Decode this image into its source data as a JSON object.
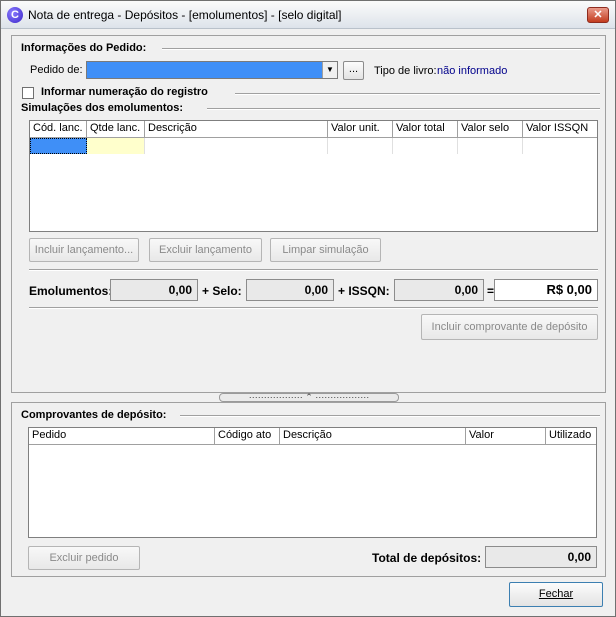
{
  "window": {
    "title": "Nota de entrega - Depósitos - [emolumentos] - [selo digital]",
    "close_glyph": "✕"
  },
  "pedido_info": {
    "group_title": "Informações do Pedido:",
    "pedido_label": "Pedido de:",
    "pedido_value": "",
    "browse_label": "...",
    "tipo_livro_label": "Tipo de livro:",
    "tipo_livro_value": "não informado"
  },
  "informar_numeracao": {
    "label": "Informar numeração do registro",
    "checked": false
  },
  "simulacoes": {
    "group_title": "Simulações dos emolumentos:",
    "columns": [
      "Cód. lanc.",
      "Qtde lanc.",
      "Descrição",
      "Valor unit.",
      "Valor total",
      "Valor selo",
      "Valor ISSQN"
    ],
    "rows": []
  },
  "actions": {
    "incluir_lancamento": "Incluir lançamento...",
    "excluir_lancamento": "Excluir lançamento",
    "limpar_simulacao": "Limpar simulação",
    "incluir_comprovante": "Incluir comprovante de depósito"
  },
  "totais": {
    "emolumentos_label": "Emolumentos:",
    "emolumentos_value": "0,00",
    "selo_label": "+ Selo:",
    "selo_value": "0,00",
    "issqn_label": "+ ISSQN:",
    "issqn_value": "0,00",
    "equals_label": "=",
    "total_value": "R$ 0,00"
  },
  "comprovantes": {
    "group_title": "Comprovantes de depósito:",
    "columns": [
      "Pedido",
      "Código ato",
      "Descrição",
      "Valor",
      "Utilizado"
    ],
    "excluir_pedido": "Excluir pedido",
    "total_label": "Total de depósitos:",
    "total_value": "0,00"
  },
  "footer": {
    "fechar_label": "Fechar"
  },
  "colors": {
    "selection": "#3f8ff7",
    "edit_cell": "#ffffcc",
    "link_text": "#00008b"
  }
}
